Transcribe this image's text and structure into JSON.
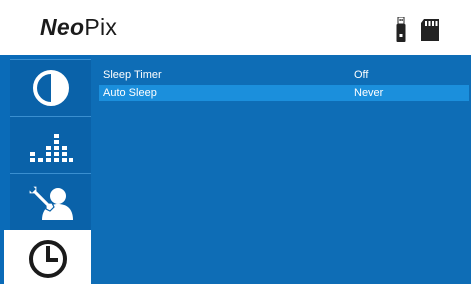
{
  "header": {
    "logo_bold": "Neo",
    "logo_light": "Pix",
    "status_icons": [
      "usb-drive-icon",
      "sd-card-icon"
    ]
  },
  "sidebar": {
    "tabs": [
      {
        "name": "picture",
        "icon": "contrast-icon",
        "active": false
      },
      {
        "name": "sound",
        "icon": "equalizer-icon",
        "active": false
      },
      {
        "name": "setup",
        "icon": "settings-user-icon",
        "active": false
      },
      {
        "name": "timer",
        "icon": "clock-icon",
        "active": true
      }
    ]
  },
  "menu": {
    "items": [
      {
        "label": "Sleep Timer",
        "value": "Off",
        "selected": false
      },
      {
        "label": "Auto Sleep",
        "value": "Never",
        "selected": true
      }
    ]
  },
  "colors": {
    "panel_blue": "#0e6db6",
    "sidebar_blue": "#0a62a9",
    "highlight_blue": "#1b8fdc"
  }
}
